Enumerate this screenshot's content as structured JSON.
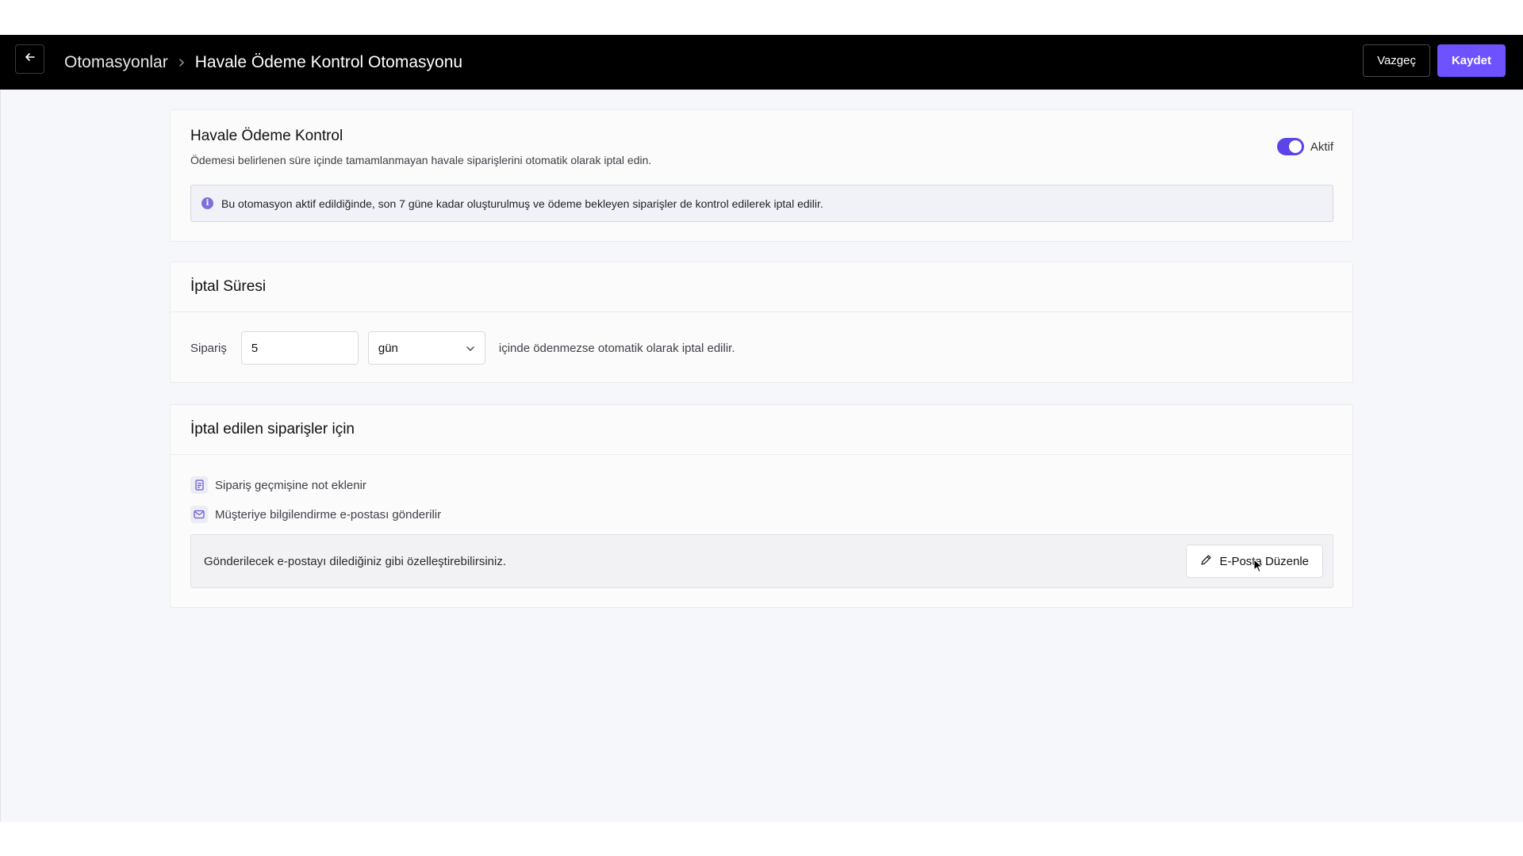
{
  "header": {
    "breadcrumb_parent": "Otomasyonlar",
    "breadcrumb_current": "Havale Ödeme Kontrol Otomasyonu",
    "cancel_label": "Vazgeç",
    "save_label": "Kaydet",
    "back_icon": "arrow-left-icon",
    "separator_icon": "chevron-right-icon"
  },
  "automation": {
    "title": "Havale Ödeme Kontrol",
    "description": "Ödemesi belirlenen süre içinde tamamlanmayan havale siparişlerini otomatik olarak iptal edin.",
    "toggle_label": "Aktif",
    "toggle_on": true,
    "info_text": "Bu otomasyon aktif edildiğinde, son 7 güne kadar oluşturulmuş ve ödeme bekleyen siparişler de kontrol edilerek iptal edilir."
  },
  "cancel_duration": {
    "title": "İptal Süresi",
    "prefix_label": "Sipariş",
    "amount_value": "5",
    "unit_value": "gün",
    "suffix_text": "içinde ödenmezse otomatik olarak iptal edilir."
  },
  "cancelled_orders": {
    "title": "İptal edilen siparişler için",
    "items": [
      {
        "icon": "note-icon",
        "label": "Sipariş geçmişine not eklenir"
      },
      {
        "icon": "mail-icon",
        "label": "Müşteriye bilgilendirme e-postası gönderilir"
      }
    ],
    "email_hint": "Gönderilecek e-postayı dilediğiniz gibi özelleştirebilirsiniz.",
    "edit_email_label": "E-Posta Düzenle"
  },
  "colors": {
    "accent": "#6f52ff",
    "header_bg": "#000000",
    "page_bg": "#f6f7fa"
  }
}
